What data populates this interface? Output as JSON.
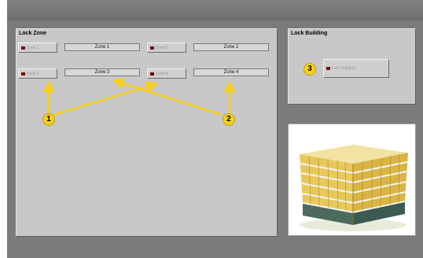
{
  "lock_zone": {
    "title": "Lock Zone",
    "zones": [
      {
        "button_label": "Zone 1",
        "field_value": "Zone 1"
      },
      {
        "button_label": "Zone 2",
        "field_value": "Zone 2"
      },
      {
        "button_label": "Zone 3",
        "field_value": "Zone 3"
      },
      {
        "button_label": "Zone 4",
        "field_value": "Zone 4"
      }
    ]
  },
  "lock_building": {
    "title": "Lock Building",
    "button_label": "Lock Building"
  },
  "callouts": [
    "1",
    "2",
    "3"
  ],
  "colors": {
    "panel": "#c8c8c8",
    "frame": "#7b7b7b",
    "callout": "#f6d01b",
    "led": "#6e1010"
  }
}
